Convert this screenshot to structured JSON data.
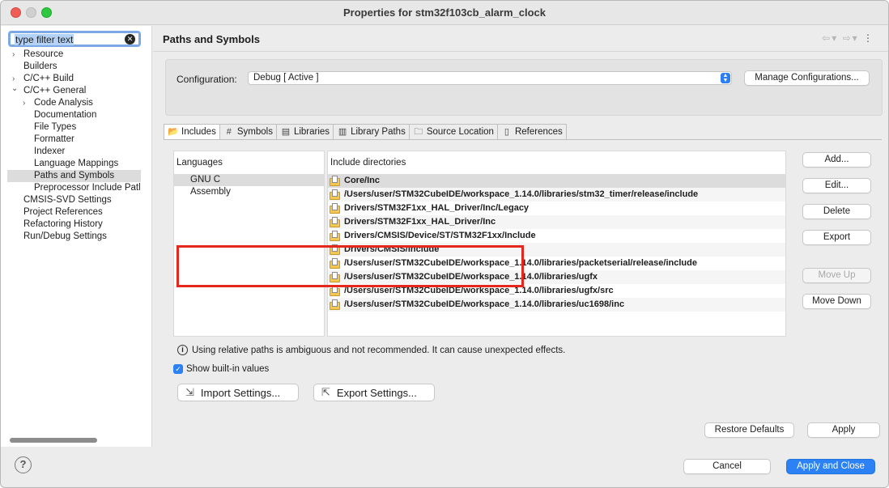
{
  "window": {
    "title": "Properties for stm32f103cb_alarm_clock"
  },
  "sidebar": {
    "filter_placeholder": "type filter text",
    "items": [
      {
        "label": "Resource",
        "arrow": "›"
      },
      {
        "label": "Builders",
        "arrow": ""
      },
      {
        "label": "C/C++ Build",
        "arrow": "›"
      },
      {
        "label": "C/C++ General",
        "arrow": "⌄"
      },
      {
        "label": "Code Analysis",
        "arrow": "›"
      },
      {
        "label": "Documentation",
        "arrow": ""
      },
      {
        "label": "File Types",
        "arrow": ""
      },
      {
        "label": "Formatter",
        "arrow": ""
      },
      {
        "label": "Indexer",
        "arrow": ""
      },
      {
        "label": "Language Mappings",
        "arrow": ""
      },
      {
        "label": "Paths and Symbols",
        "arrow": ""
      },
      {
        "label": "Preprocessor Include Patl",
        "arrow": ""
      },
      {
        "label": "CMSIS-SVD Settings",
        "arrow": ""
      },
      {
        "label": "Project References",
        "arrow": ""
      },
      {
        "label": "Refactoring History",
        "arrow": ""
      },
      {
        "label": "Run/Debug Settings",
        "arrow": ""
      }
    ]
  },
  "page": {
    "title": "Paths and Symbols",
    "configuration_label": "Configuration:",
    "configuration_value": "Debug  [ Active ]",
    "manage_button": "Manage Configurations..."
  },
  "tabs": [
    "Includes",
    "Symbols",
    "Libraries",
    "Library Paths",
    "Source Location",
    "References"
  ],
  "languages": {
    "header": "Languages",
    "items": [
      "GNU C",
      "Assembly"
    ]
  },
  "include_dirs": {
    "header": "Include directories",
    "items": [
      "Core/Inc",
      "/Users/user/STM32CubeIDE/workspace_1.14.0/libraries/stm32_timer/release/include",
      "Drivers/STM32F1xx_HAL_Driver/Inc/Legacy",
      "Drivers/STM32F1xx_HAL_Driver/Inc",
      "Drivers/CMSIS/Device/ST/STM32F1xx/Include",
      "Drivers/CMSIS/Include",
      "/Users/user/STM32CubeIDE/workspace_1.14.0/libraries/packetserial/release/include",
      "/Users/user/STM32CubeIDE/workspace_1.14.0/libraries/ugfx",
      "/Users/user/STM32CubeIDE/workspace_1.14.0/libraries/ugfx/src",
      "/Users/user/STM32CubeIDE/workspace_1.14.0/libraries/uc1698/inc"
    ]
  },
  "side_buttons": {
    "add": "Add...",
    "edit": "Edit...",
    "delete": "Delete",
    "export": "Export",
    "move_up": "Move Up",
    "move_down": "Move Down"
  },
  "info_text": "Using relative paths is ambiguous and not recommended. It can cause unexpected effects.",
  "show_builtin": "Show built-in values",
  "import_settings": "Import Settings...",
  "export_settings": "Export Settings...",
  "restore_defaults": "Restore Defaults",
  "apply": "Apply",
  "cancel": "Cancel",
  "apply_close": "Apply and Close",
  "help": "?"
}
